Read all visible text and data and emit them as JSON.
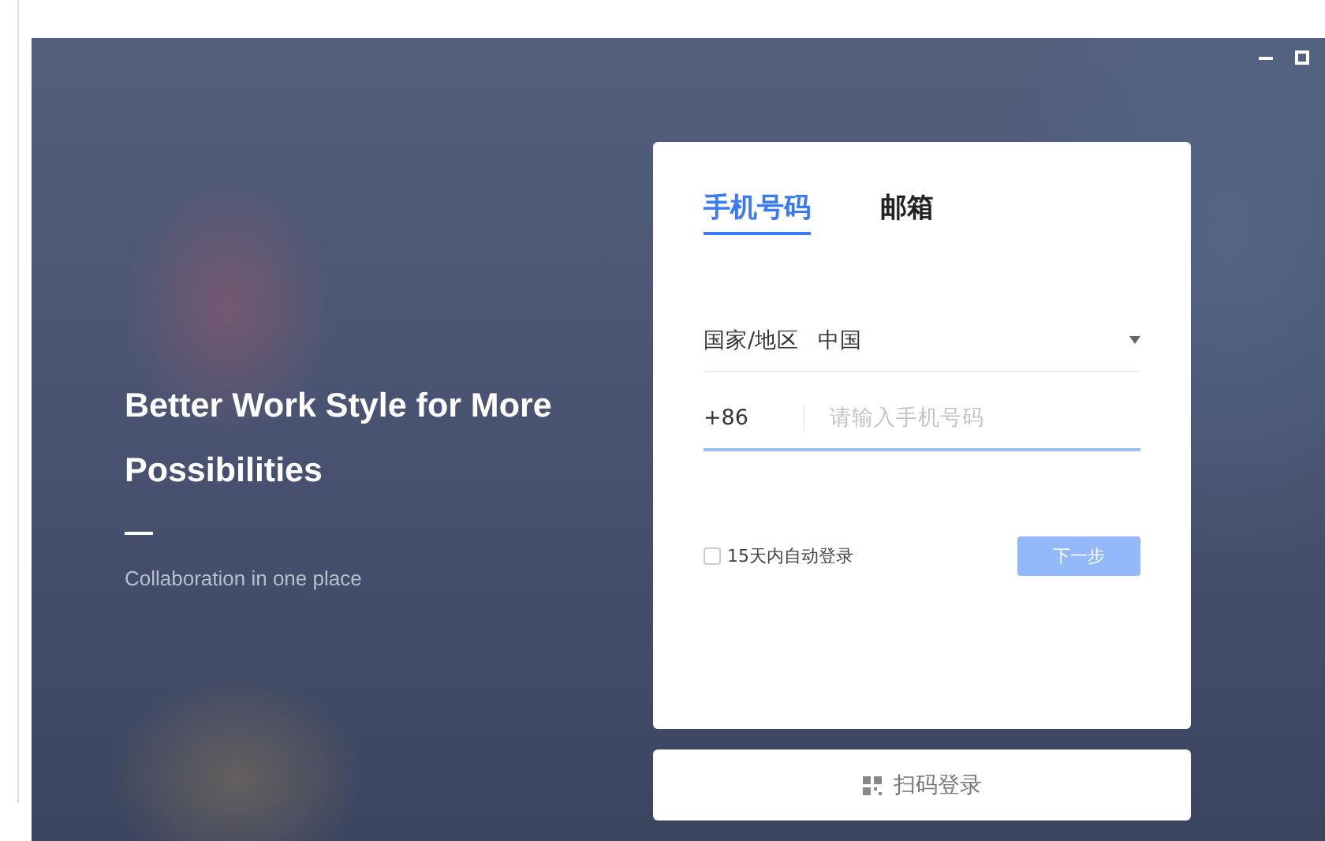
{
  "hero": {
    "title": "Better Work Style for More Possibilities",
    "subtitle": "Collaboration in one place"
  },
  "tabs": [
    {
      "label": "手机号码",
      "selected": true
    },
    {
      "label": "邮箱",
      "selected": false
    }
  ],
  "region": {
    "label": "国家/地区",
    "value": "中国"
  },
  "phone": {
    "prefix": "+86",
    "placeholder": "请输入手机号码"
  },
  "remember": {
    "label": "15天内自动登录",
    "checked": false
  },
  "next_button": {
    "label": "下一步",
    "disabled": true
  },
  "qr_login": {
    "label": "扫码登录"
  }
}
